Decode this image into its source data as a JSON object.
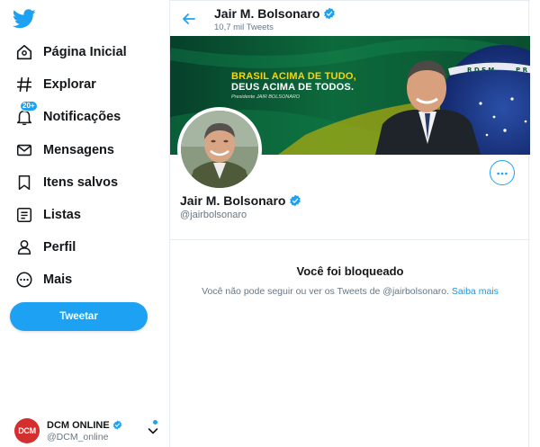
{
  "sidebar": {
    "logo": "twitter-bird-icon",
    "nav": [
      {
        "label": "Página Inicial",
        "icon": "home-icon"
      },
      {
        "label": "Explorar",
        "icon": "hashtag-icon"
      },
      {
        "label": "Notificações",
        "icon": "bell-icon",
        "badge": "20+"
      },
      {
        "label": "Mensagens",
        "icon": "mail-icon"
      },
      {
        "label": "Itens salvos",
        "icon": "bookmark-icon"
      },
      {
        "label": "Listas",
        "icon": "list-icon"
      },
      {
        "label": "Perfil",
        "icon": "person-icon"
      },
      {
        "label": "Mais",
        "icon": "more-circle-icon"
      }
    ],
    "tweet_button": "Tweetar",
    "account": {
      "avatar_text": "DCM",
      "name": "DCM ONLINE",
      "handle": "@DCM_online"
    }
  },
  "header": {
    "name": "Jair M. Bolsonaro",
    "tweet_count": "10,7 mil Tweets"
  },
  "banner": {
    "line1": "BRASIL ACIMA DE TUDO,",
    "line2": "DEUS ACIMA DE TODOS.",
    "caption": "Presidente JAIR BOLSONARO"
  },
  "profile": {
    "name": "Jair M. Bolsonaro",
    "handle": "@jairbolsonaro"
  },
  "blocked": {
    "title": "Você foi bloqueado",
    "message": "Você não pode seguir ou ver os Tweets de @jairbolsonaro.",
    "link": "Saiba mais"
  },
  "colors": {
    "accent": "#1da1f2",
    "text": "#14171a",
    "secondary_text": "#657786",
    "border": "#e6ecf0",
    "banner_yellow": "#ffd400",
    "banner_green": "#0a5b33"
  }
}
